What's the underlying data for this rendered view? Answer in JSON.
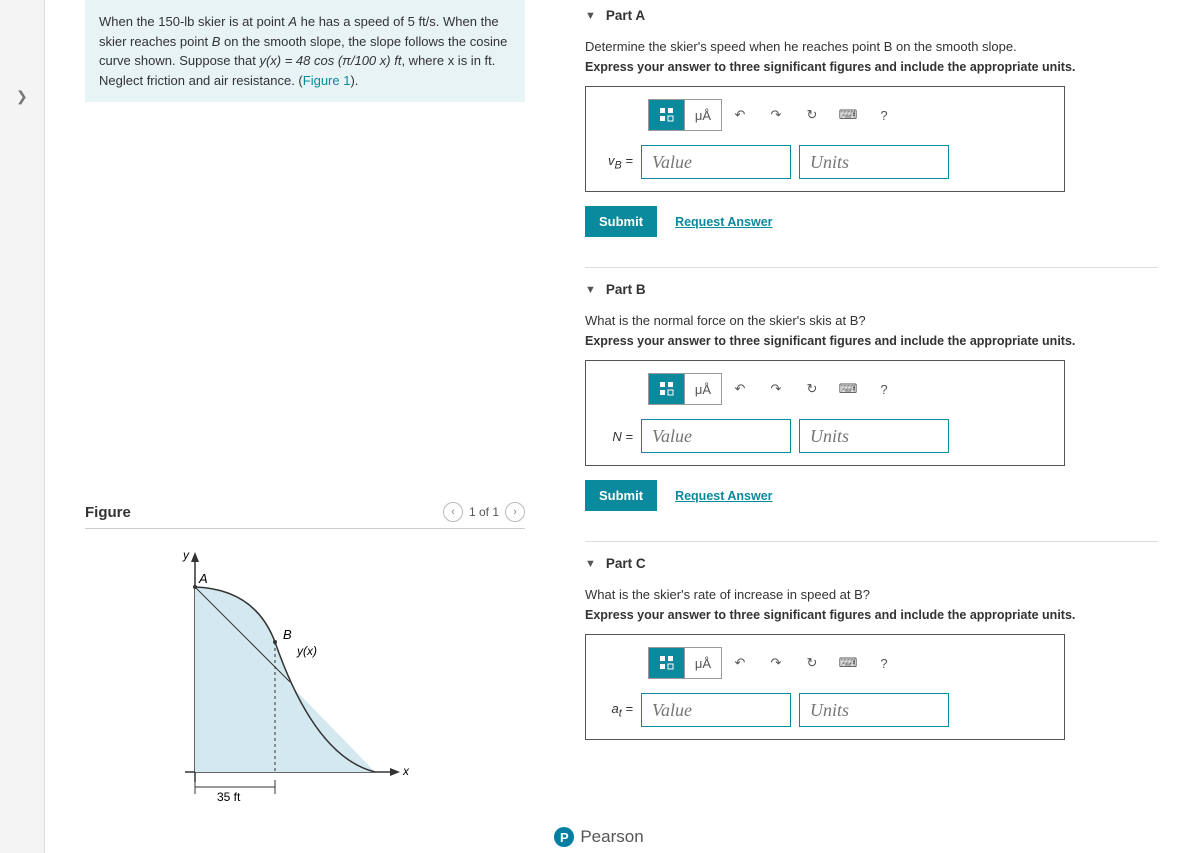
{
  "problem": {
    "text_prefix": "When the 150-",
    "unit_lb": "lb",
    "text_mid1": " skier is at point ",
    "pt_A": "A",
    "text_mid2": " he has a speed of 5 ",
    "unit_fts": "ft/s",
    "text_mid3": ". When the skier reaches point ",
    "pt_B": "B",
    "text_mid4": " on the smooth slope, the slope follows the cosine curve shown. Suppose that ",
    "eq": "y(x) = 48 cos (π/100 x)  ft",
    "text_end": ", where x is in ft. Neglect friction and air resistance. (",
    "fig_link": "Figure 1",
    "close": ")."
  },
  "figure": {
    "title": "Figure",
    "pager": "1 of 1",
    "labels": {
      "y": "y",
      "x": "x",
      "A": "A",
      "B": "B",
      "curve": "y(x)",
      "dist": "35 ft"
    }
  },
  "partA": {
    "title": "Part A",
    "prompt": "Determine the skier's speed when he reaches point B on the smooth slope.",
    "sub": "Express your answer to three significant figures and include the appropriate units.",
    "var": "v_B =",
    "value_ph": "Value",
    "units_ph": "Units"
  },
  "partB": {
    "title": "Part B",
    "prompt": "What is the normal force on the skier's skis at B?",
    "sub": "Express your answer to three significant figures and include the appropriate units.",
    "var": "N =",
    "value_ph": "Value",
    "units_ph": "Units"
  },
  "partC": {
    "title": "Part C",
    "prompt": "What is the skier's rate of increase in speed at B?",
    "sub": "Express your answer to three significant figures and include the appropriate units.",
    "var": "a_t =",
    "value_ph": "Value",
    "units_ph": "Units"
  },
  "toolbar": {
    "mu": "μÅ",
    "help": "?"
  },
  "actions": {
    "submit": "Submit",
    "request": "Request Answer"
  },
  "footer": {
    "brand": "Pearson"
  }
}
